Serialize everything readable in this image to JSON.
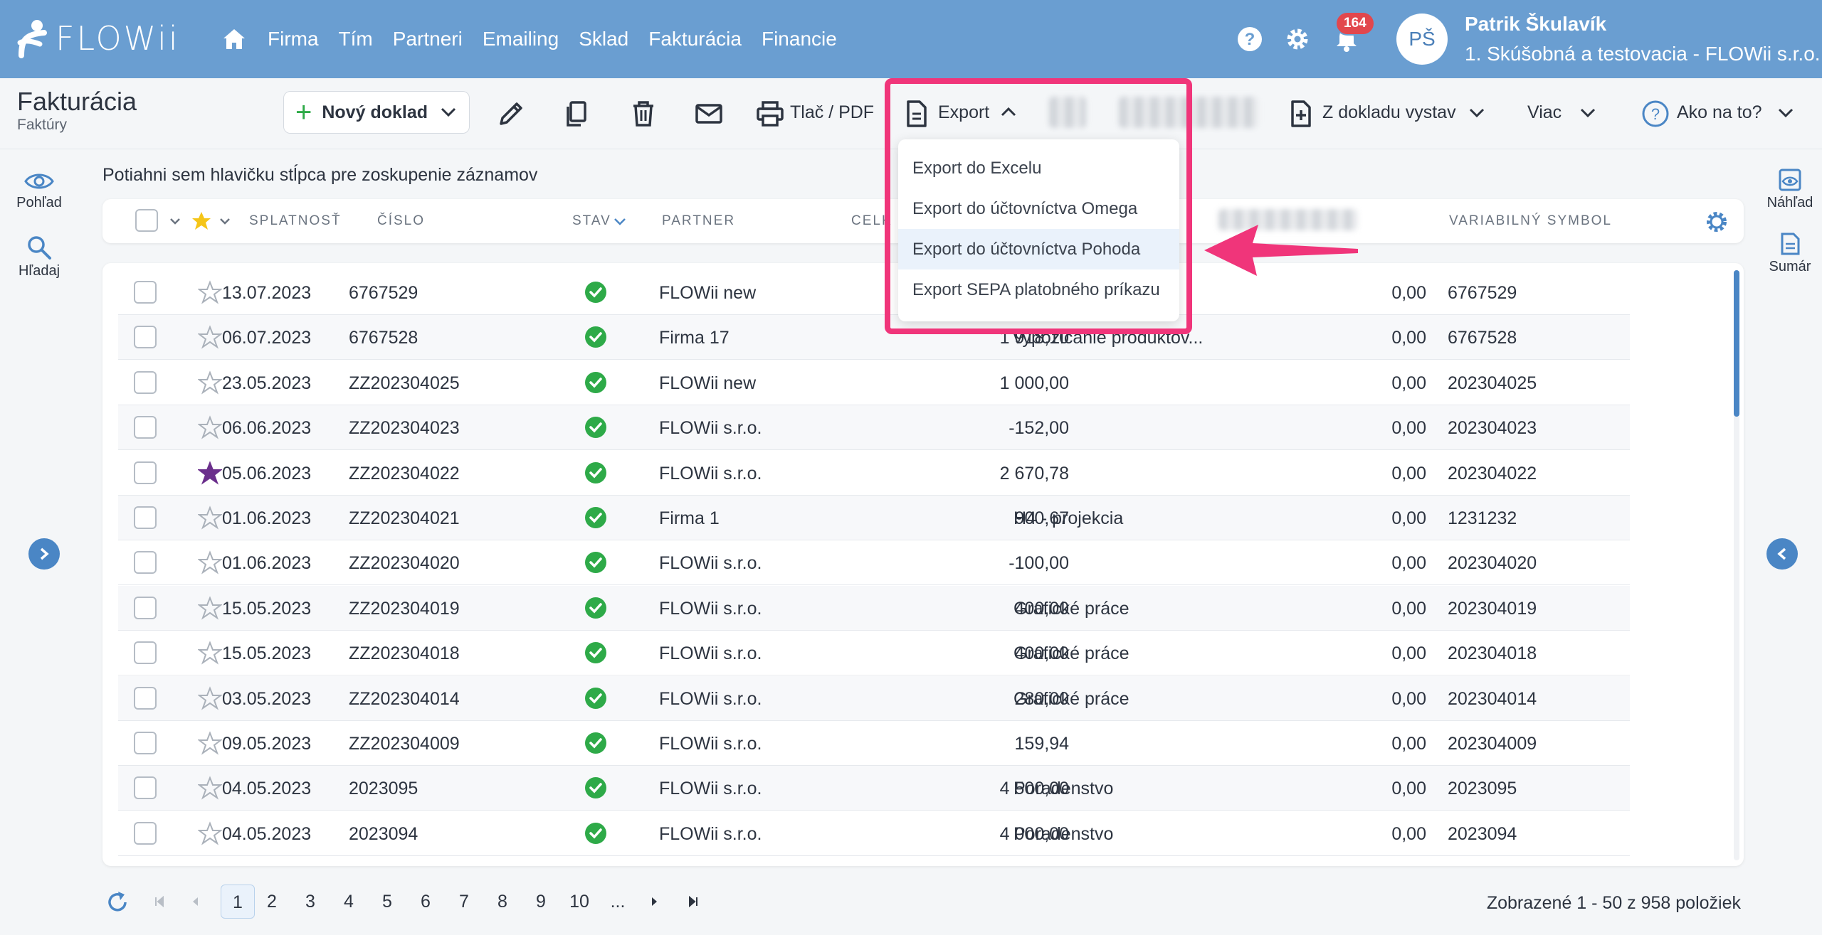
{
  "app": {
    "name": "FLOWii"
  },
  "nav": {
    "items": [
      "Firma",
      "Tím",
      "Partneri",
      "Emailing",
      "Sklad",
      "Fakturácia",
      "Financie"
    ]
  },
  "notifications": {
    "count": "164"
  },
  "user": {
    "initials": "PŠ",
    "name": "Patrik Škulavík",
    "org": "1. Skúšobná a testovacia - FLOWii s.r.o."
  },
  "page": {
    "title": "Fakturácia",
    "subtitle": "Faktúry"
  },
  "toolbar": {
    "new_label": "Nový doklad",
    "print_label": "Tlač / PDF",
    "export_label": "Export",
    "from_doc_label": "Z dokladu vystav",
    "more_label": "Viac",
    "help_label": "Ako na to?"
  },
  "export_menu": {
    "items": [
      "Export do Excelu",
      "Export do účtovníctva Omega",
      "Export do účtovníctva Pohoda",
      "Export SEPA platobného príkazu"
    ],
    "selected": "Export do účtovníctva Pohoda"
  },
  "side_left": {
    "view_label": "Pohľad",
    "search_label": "Hľadaj"
  },
  "side_right": {
    "preview_label": "Náhľad",
    "summary_label": "Sumár"
  },
  "group_hint": "Potiahni sem hlavičku stĺpca pre zoskupenie záznamov",
  "columns": {
    "due": "SPLATNOSŤ",
    "number": "ČÍSLO",
    "status": "STAV",
    "partner": "PARTNER",
    "total": "CELK",
    "vs": "VARIABILNÝ SYMBOL"
  },
  "rows": [
    {
      "due": "13.07.2023",
      "number": "6767529",
      "partner": "FLOWii new",
      "total": "",
      "desc": "",
      "paid": "0,00",
      "vs": "6767529",
      "starred": false
    },
    {
      "due": "06.07.2023",
      "number": "6767528",
      "partner": "Firma 17",
      "total": "1 918,10",
      "desc": "vypozičanie produktov...",
      "paid": "0,00",
      "vs": "6767528",
      "starred": false
    },
    {
      "due": "23.05.2023",
      "number": "ZZ202304025",
      "partner": "FLOWii new",
      "total": "1 000,00",
      "desc": "",
      "paid": "0,00",
      "vs": "202304025",
      "starred": false
    },
    {
      "due": "06.06.2023",
      "number": "ZZ202304023",
      "partner": "FLOWii s.r.o.",
      "total": "-152,00",
      "desc": "",
      "paid": "0,00",
      "vs": "202304023",
      "starred": false
    },
    {
      "due": "05.06.2023",
      "number": "ZZ202304022",
      "partner": "FLOWii s.r.o.",
      "total": "2 670,78",
      "desc": "",
      "paid": "0,00",
      "vs": "202304022",
      "starred": true
    },
    {
      "due": "01.06.2023",
      "number": "ZZ202304021",
      "partner": "Firma 1",
      "total": "900,67",
      "desc": "H4 - projekcia",
      "paid": "0,00",
      "vs": "1231232",
      "starred": false
    },
    {
      "due": "01.06.2023",
      "number": "ZZ202304020",
      "partner": "FLOWii s.r.o.",
      "total": "-100,00",
      "desc": "",
      "paid": "0,00",
      "vs": "202304020",
      "starred": false
    },
    {
      "due": "15.05.2023",
      "number": "ZZ202304019",
      "partner": "FLOWii s.r.o.",
      "total": "400,00",
      "desc": "Grafické práce",
      "paid": "0,00",
      "vs": "202304019",
      "starred": false
    },
    {
      "due": "15.05.2023",
      "number": "ZZ202304018",
      "partner": "FLOWii s.r.o.",
      "total": "400,00",
      "desc": "Grafické práce",
      "paid": "0,00",
      "vs": "202304018",
      "starred": false
    },
    {
      "due": "03.05.2023",
      "number": "ZZ202304014",
      "partner": "FLOWii s.r.o.",
      "total": "280,00",
      "desc": "Grafické práce",
      "paid": "0,00",
      "vs": "202304014",
      "starred": false
    },
    {
      "due": "09.05.2023",
      "number": "ZZ202304009",
      "partner": "FLOWii s.r.o.",
      "total": "159,94",
      "desc": "",
      "paid": "0,00",
      "vs": "202304009",
      "starred": false
    },
    {
      "due": "04.05.2023",
      "number": "2023095",
      "partner": "FLOWii s.r.o.",
      "total": "4 500,00",
      "desc": "Poradenstvo",
      "paid": "0,00",
      "vs": "2023095",
      "starred": false
    },
    {
      "due": "04.05.2023",
      "number": "2023094",
      "partner": "FLOWii s.r.o.",
      "total": "4 000,00",
      "desc": "Poradenstvo",
      "paid": "0,00",
      "vs": "2023094",
      "starred": false
    }
  ],
  "pager": {
    "pages": [
      "1",
      "2",
      "3",
      "4",
      "5",
      "6",
      "7",
      "8",
      "9",
      "10",
      "..."
    ],
    "current": "1",
    "info": "Zobrazené 1 - 50 z 958 položiek"
  },
  "colors": {
    "topbar": "#6a9ed1",
    "accent": "#4a86c5",
    "highlight": "#f0357a",
    "ok": "#2eaa48",
    "star_active": "#6b2f8c"
  }
}
